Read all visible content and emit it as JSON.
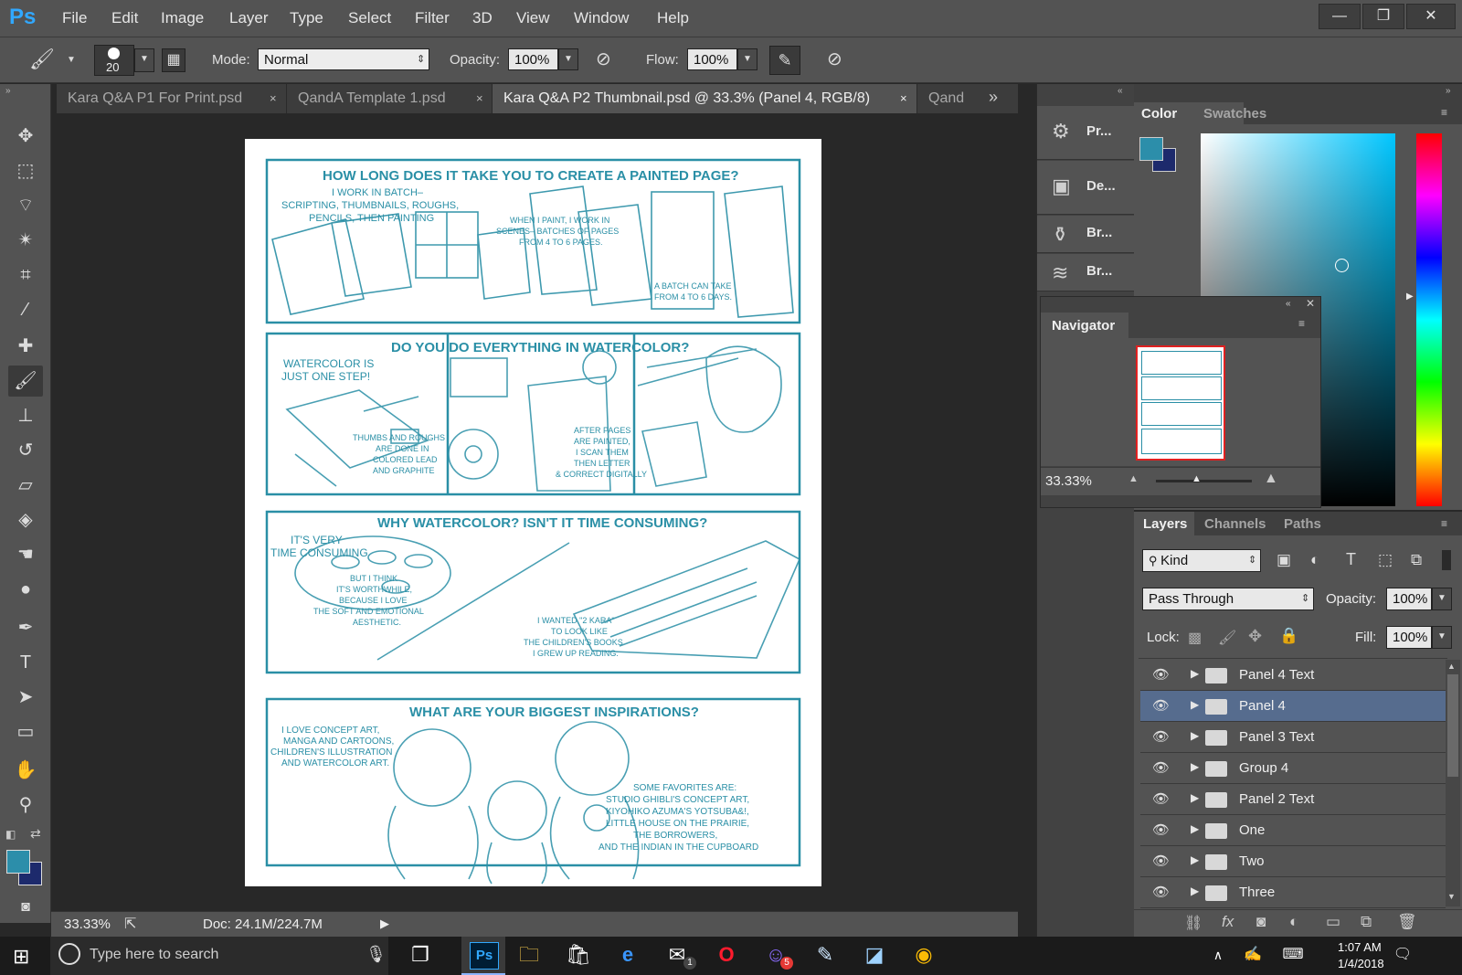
{
  "app": {
    "logo": "Ps",
    "menu": [
      "File",
      "Edit",
      "Image",
      "Layer",
      "Type",
      "Select",
      "Filter",
      "3D",
      "View",
      "Window",
      "Help"
    ]
  },
  "window": {
    "minimize": "—",
    "restore": "❐",
    "close": "✕"
  },
  "options": {
    "brush_size": "20",
    "mode_label": "Mode:",
    "mode_value": "Normal",
    "opacity_label": "Opacity:",
    "opacity_value": "100%",
    "flow_label": "Flow:",
    "flow_value": "100%"
  },
  "tabs": [
    {
      "label": "Kara Q&A P1 For Print.psd",
      "close": "×"
    },
    {
      "label": "QandA Template 1.psd",
      "close": "×"
    },
    {
      "label": "Kara Q&A P2 Thumbnail.psd @ 33.3% (Panel 4, RGB/8)",
      "close": "×"
    },
    {
      "label": "Qand"
    }
  ],
  "tab_overflow": "»",
  "status": {
    "zoom": "33.33%",
    "doc": "Doc: 24.1M/224.7M"
  },
  "colors": {
    "foreground": "#2c8eaa",
    "background": "#1d2a6c",
    "sketch": "#2a8fa6"
  },
  "dock": [
    "Pr...",
    "De...",
    "Br...",
    "Br..."
  ],
  "color_panel": {
    "tabs": [
      "Color",
      "Swatches"
    ]
  },
  "navigator": {
    "title": "Navigator",
    "zoom": "33.33%"
  },
  "layers_panel": {
    "tabs": [
      "Layers",
      "Channels",
      "Paths"
    ],
    "filter_kind": "Kind",
    "blend_mode": "Pass Through",
    "opacity_label": "Opacity:",
    "opacity_value": "100%",
    "lock_label": "Lock:",
    "fill_label": "Fill:",
    "fill_value": "100%",
    "layers": [
      {
        "name": "Panel 4 Text"
      },
      {
        "name": "Panel 4"
      },
      {
        "name": "Panel 3 Text"
      },
      {
        "name": "Group 4"
      },
      {
        "name": "Panel 2 Text"
      },
      {
        "name": "One"
      },
      {
        "name": "Two"
      },
      {
        "name": "Three"
      }
    ],
    "footer_fx": "fx"
  },
  "artwork": {
    "panel1_title": "HOW LONG DOES IT TAKE YOU TO CREATE A PAINTED PAGE?",
    "panel1_text_a": "I WORK IN BATCH–",
    "panel1_text_b": "SCRIPTING, THUMBNAILS, ROUGHS,",
    "panel1_text_c": "PENCILS, THEN PAINTING",
    "panel1_text_d": "WHEN I PAINT, I WORK IN",
    "panel1_text_e": "SCENES– BATCHES OF PAGES",
    "panel1_text_f": "FROM 4 TO 6 PAGES.",
    "panel1_text_g": "A BATCH CAN TAKE",
    "panel1_text_h": "FROM 4 TO 6 DAYS.",
    "panel2_title": "DO YOU DO EVERYTHING IN WATERCOLOR?",
    "panel2_text_a": "WATERCOLOR IS",
    "panel2_text_b": "JUST ONE STEP!",
    "panel2_text_c": "THUMBS AND ROUGHS",
    "panel2_text_d": "ARE DONE IN",
    "panel2_text_e": "COLORED LEAD",
    "panel2_text_f": "AND GRAPHITE",
    "panel2_text_g": "AFTER PAGES",
    "panel2_text_h": "ARE PAINTED,",
    "panel2_text_i": "I SCAN THEM",
    "panel2_text_j": "THEN LETTER",
    "panel2_text_k": "& CORRECT DIGITALLY",
    "panel3_title": "WHY WATERCOLOR?  ISN'T IT TIME CONSUMING?",
    "panel3_text_a": "IT'S VERY",
    "panel3_text_b": "TIME CONSUMING",
    "panel3_text_c": "BUT I THINK",
    "panel3_text_d": "IT'S WORTHWHILE,",
    "panel3_text_e": "BECAUSE I LOVE",
    "panel3_text_f": "THE SOFT AND EMOTIONAL",
    "panel3_text_g": "AESTHETIC.",
    "panel3_text_h": "I WANTED \"2 KARA\"",
    "panel3_text_i": "TO LOOK LIKE",
    "panel3_text_j": "THE CHILDREN'S BOOKS",
    "panel3_text_k": "I GREW UP READING.",
    "panel4_title": "WHAT ARE YOUR BIGGEST INSPIRATIONS?",
    "panel4_text_a": "I LOVE CONCEPT ART,",
    "panel4_text_b": "MANGA AND CARTOONS,",
    "panel4_text_c": "CHILDREN'S ILLUSTRATION",
    "panel4_text_d": "AND WATERCOLOR ART.",
    "panel4_text_e": "SOME FAVORITES ARE:",
    "panel4_text_f": "STUDIO GHIBLI'S CONCEPT ART,",
    "panel4_text_g": "KIYOHIKO AZUMA'S YOTSUBA&!,",
    "panel4_text_h": "LITTLE HOUSE ON THE PRAIRIE,",
    "panel4_text_i": "THE BORROWERS,",
    "panel4_text_j": "AND THE INDIAN IN THE CUPBOARD"
  },
  "taskbar": {
    "search_placeholder": "Type here to search",
    "time": "1:07 AM",
    "date": "1/4/2018",
    "badge": "5",
    "mail_badge": "1"
  }
}
